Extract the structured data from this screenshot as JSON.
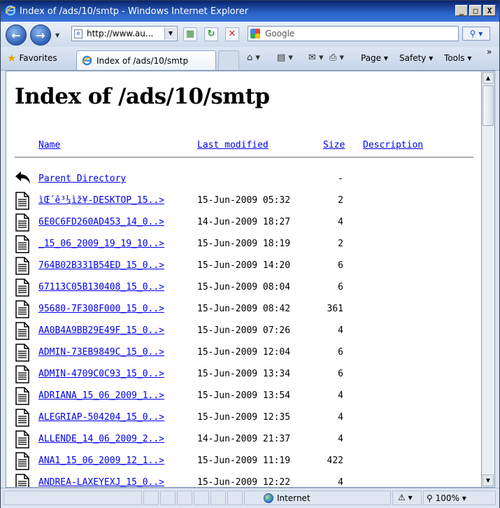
{
  "window": {
    "title": "Index of /ads/10/smtp - Windows Internet Explorer",
    "controls": {
      "minimize": "_",
      "maximize": "□",
      "close": "X"
    }
  },
  "nav": {
    "address": "http://www.au...",
    "search_placeholder": "Google"
  },
  "favorites_bar": {
    "favorites_label": "Favorites",
    "tab_title": "Index of /ads/10/smtp",
    "commands": {
      "page": "Page ▾",
      "safety": "Safety ▾",
      "tools": "Tools ▾",
      "more": "»"
    }
  },
  "page": {
    "heading": "Index of /ads/10/smtp",
    "columns": {
      "name": "Name",
      "last_modified": "Last modified",
      "size": "Size",
      "description": "Description"
    },
    "parent": {
      "name": "Parent Directory",
      "size": "-"
    },
    "rows": [
      {
        "name": "ìŒ´ê³¼ìž¥-DESKTOP_15..>",
        "date": "15-Jun-2009 05:32",
        "size": "2"
      },
      {
        "name": "6E0C6FD260AD453_14_0..>",
        "date": "14-Jun-2009 18:27",
        "size": "4"
      },
      {
        "name": "_15_06_2009_19_19_10..>",
        "date": "15-Jun-2009 18:19",
        "size": "2"
      },
      {
        "name": "764B02B331B54ED_15_0..>",
        "date": "15-Jun-2009 14:20",
        "size": "6"
      },
      {
        "name": "67113C05B130408_15_0..>",
        "date": "15-Jun-2009 08:04",
        "size": "6"
      },
      {
        "name": "95680-7F308F000_15_0..>",
        "date": "15-Jun-2009 08:42",
        "size": "361"
      },
      {
        "name": "AA0B4A9BB29E49F_15_0..>",
        "date": "15-Jun-2009 07:26",
        "size": "4"
      },
      {
        "name": "ADMIN-73EB9849C_15_0..>",
        "date": "15-Jun-2009 12:04",
        "size": "6"
      },
      {
        "name": "ADMIN-4709C0C93_15_0..>",
        "date": "15-Jun-2009 13:34",
        "size": "6"
      },
      {
        "name": "ADRIANA_15_06_2009_1..>",
        "date": "15-Jun-2009 13:54",
        "size": "4"
      },
      {
        "name": "ALEGRIAP-504204_15_0..>",
        "date": "15-Jun-2009 12:35",
        "size": "4"
      },
      {
        "name": "ALLENDE_14_06_2009_2..>",
        "date": "14-Jun-2009 21:37",
        "size": "4"
      },
      {
        "name": "ANA1_15_06_2009_12_1..>",
        "date": "15-Jun-2009 11:19",
        "size": "422"
      },
      {
        "name": "ANDREA-LAXEYEXJ_15_0..>",
        "date": "15-Jun-2009 12:22",
        "size": "4"
      }
    ]
  },
  "status": {
    "zone": "Internet",
    "zoom": "100%"
  }
}
